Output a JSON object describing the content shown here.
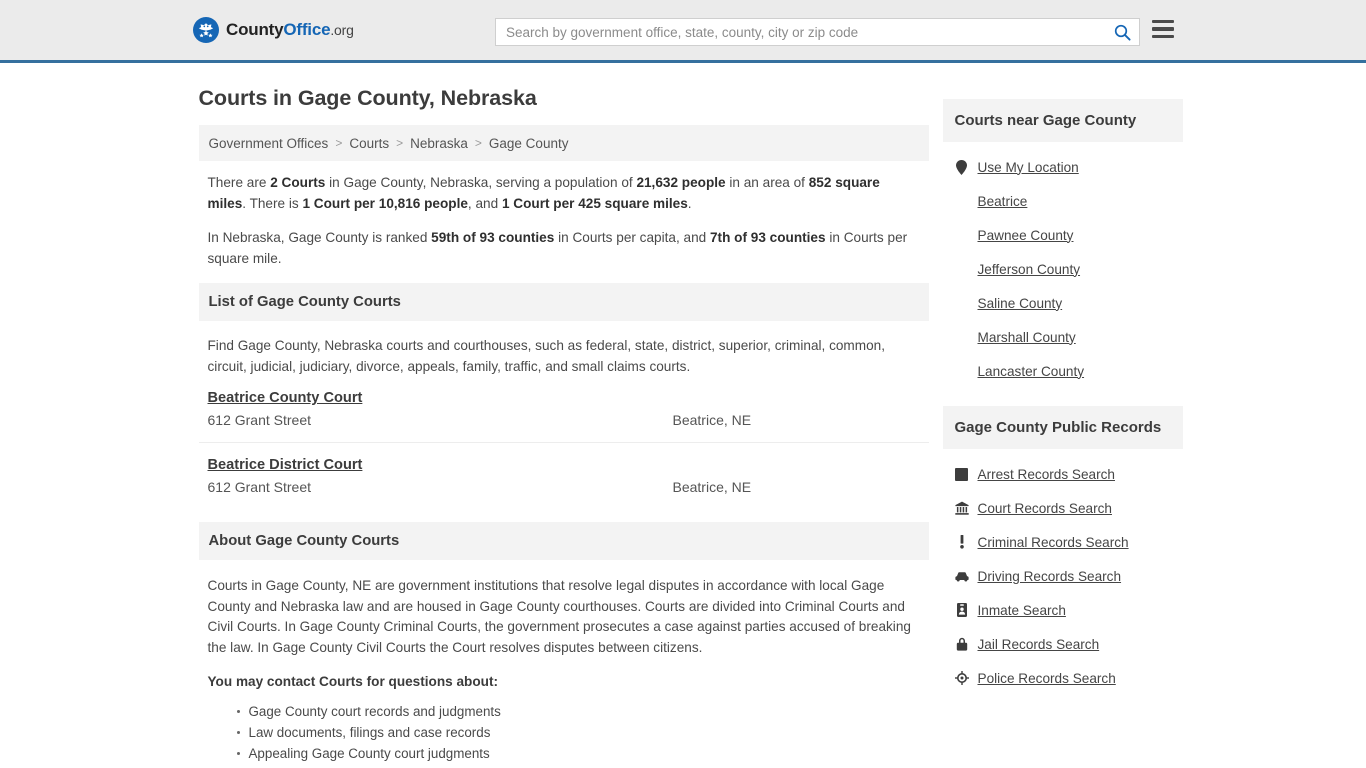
{
  "header": {
    "logo": {
      "icon": "eagle-seal-logo",
      "text_county": "County",
      "text_office": "Office",
      "text_org": ".org"
    },
    "search": {
      "placeholder": "Search by government office, state, county, city or zip code",
      "value": "",
      "icon": "search-icon"
    },
    "menu_icon": "hamburger-menu-icon"
  },
  "page_title": "Courts in Gage County, Nebraska",
  "breadcrumb": {
    "items": [
      {
        "label": "Government Offices",
        "link": true
      },
      {
        "label": "Courts",
        "link": true
      },
      {
        "label": "Nebraska",
        "link": true
      },
      {
        "label": "Gage County",
        "link": false
      }
    ],
    "separator": ">"
  },
  "stats": {
    "paragraph1": [
      {
        "t": "There are ",
        "b": false
      },
      {
        "t": "2 Courts",
        "b": true
      },
      {
        "t": " in Gage County, Nebraska, serving a population of ",
        "b": false
      },
      {
        "t": "21,632 people",
        "b": true
      },
      {
        "t": " in an area of ",
        "b": false
      },
      {
        "t": "852 square miles",
        "b": true
      },
      {
        "t": ". There is ",
        "b": false
      },
      {
        "t": "1 Court per 10,816 people",
        "b": true
      },
      {
        "t": ", and ",
        "b": false
      },
      {
        "t": "1 Court per 425 square miles",
        "b": true
      },
      {
        "t": ".",
        "b": false
      }
    ],
    "paragraph2": [
      {
        "t": "In Nebraska, Gage County is ranked ",
        "b": false
      },
      {
        "t": "59th of 93 counties",
        "b": true
      },
      {
        "t": " in Courts per capita, and ",
        "b": false
      },
      {
        "t": "7th of 93 counties",
        "b": true
      },
      {
        "t": " in Courts per square mile.",
        "b": false
      }
    ]
  },
  "list_section": {
    "heading": "List of Gage County Courts",
    "intro": "Find Gage County, Nebraska courts and courthouses, such as federal, state, district, superior, criminal, common, circuit, judicial, judiciary, divorce, appeals, family, traffic, and small claims courts.",
    "courts": [
      {
        "name": "Beatrice County Court",
        "address": "612 Grant Street",
        "city": "Beatrice, NE"
      },
      {
        "name": "Beatrice District Court",
        "address": "612 Grant Street",
        "city": "Beatrice, NE"
      }
    ]
  },
  "about_section": {
    "heading": "About Gage County Courts",
    "body": "Courts in Gage County, NE are government institutions that resolve legal disputes in accordance with local Gage County and Nebraska law and are housed in Gage County courthouses. Courts are divided into Criminal Courts and Civil Courts. In Gage County Criminal Courts, the government prosecutes a case against parties accused of breaking the law. In Gage County Civil Courts the Court resolves disputes between citizens.",
    "contact_lead": "You may contact Courts for questions about:",
    "contact_items": [
      "Gage County court records and judgments",
      "Law documents, filings and case records",
      "Appealing Gage County court judgments"
    ]
  },
  "sidebar": {
    "near": {
      "heading": "Courts near Gage County",
      "items": [
        {
          "label": "Use My Location",
          "icon": "map-pin-icon"
        },
        {
          "label": "Beatrice",
          "icon": ""
        },
        {
          "label": "Pawnee County",
          "icon": ""
        },
        {
          "label": "Jefferson County",
          "icon": ""
        },
        {
          "label": "Saline County",
          "icon": ""
        },
        {
          "label": "Marshall County",
          "icon": ""
        },
        {
          "label": "Lancaster County",
          "icon": ""
        }
      ]
    },
    "records": {
      "heading": "Gage County Public Records",
      "items": [
        {
          "label": "Arrest Records Search",
          "icon": "square-icon"
        },
        {
          "label": "Court Records Search",
          "icon": "courthouse-icon"
        },
        {
          "label": "Criminal Records Search",
          "icon": "exclamation-icon"
        },
        {
          "label": "Driving Records Search",
          "icon": "car-icon"
        },
        {
          "label": "Inmate Search",
          "icon": "id-badge-icon"
        },
        {
          "label": "Jail Records Search",
          "icon": "lock-icon"
        },
        {
          "label": "Police Records Search",
          "icon": "police-badge-icon"
        }
      ]
    }
  },
  "colors": {
    "header_bg": "#ebebeb",
    "header_border": "#35709e",
    "accent_blue": "#1566b5",
    "section_bg": "#f3f3f3",
    "text": "#4a4a4a"
  }
}
